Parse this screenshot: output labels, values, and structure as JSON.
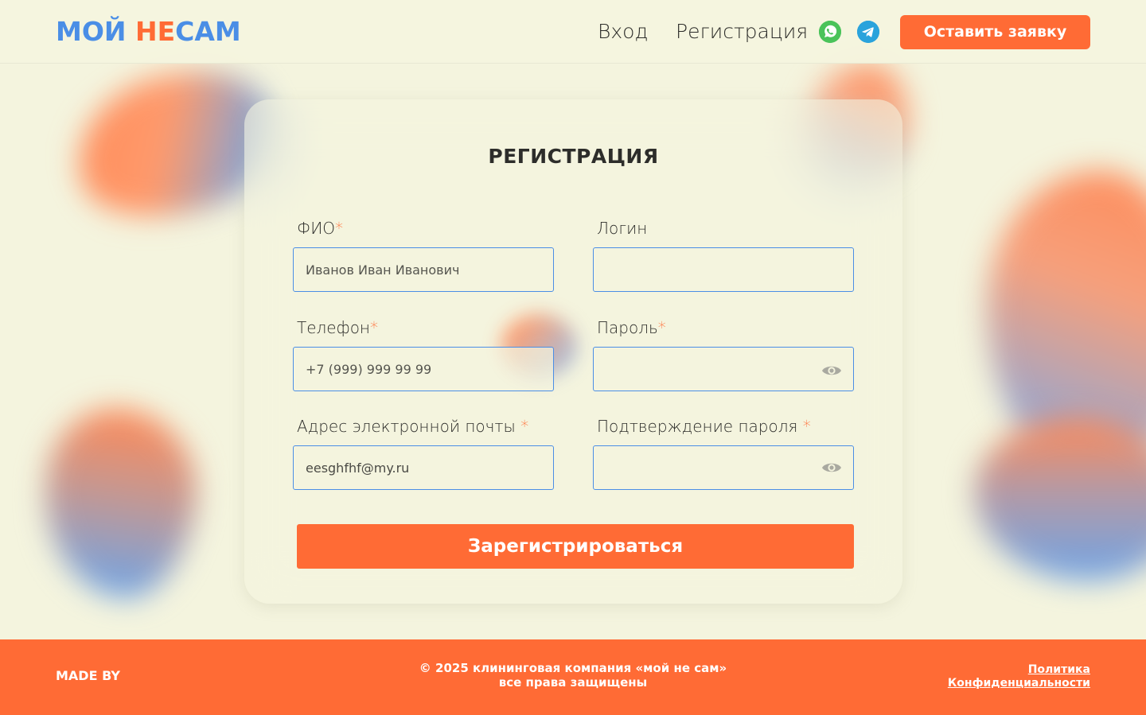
{
  "header": {
    "logo": {
      "part1": "МОЙ ",
      "part2": "НЕ",
      "part3": "САМ"
    },
    "nav": {
      "login": "Вход",
      "register": "Регистрация"
    },
    "social": [
      "whatsapp-icon",
      "telegram-icon"
    ],
    "cta_label": "Оставить заявку"
  },
  "form": {
    "title": "РЕГИСТРАЦИЯ",
    "fields": {
      "fio": {
        "label": "ФИО",
        "required": "*",
        "value": "",
        "placeholder": "Иванов Иван Иванович"
      },
      "login": {
        "label": "Логин",
        "required": "",
        "value": "",
        "placeholder": ""
      },
      "phone": {
        "label": "Телефон",
        "required": "*",
        "value": "",
        "placeholder": "+7 (999) 999 99 99"
      },
      "password": {
        "label": "Пароль",
        "required": "*",
        "value": "",
        "placeholder": ""
      },
      "email": {
        "label": "Адрес электронной почты ",
        "required": "*",
        "value": "eesghfhf@my.ru",
        "placeholder": ""
      },
      "password_confirm": {
        "label": "Подтверждение пароля ",
        "required": "*",
        "value": "",
        "placeholder": ""
      }
    },
    "submit_label": "Зарегистрироваться"
  },
  "footer": {
    "made_by": "MADE BY",
    "copyright_line1": "© 2025 клининговая компания «мой не сам»",
    "copyright_line2": "все права защищены",
    "policy_line1": "Политика",
    "policy_line2": "Конфиденциальности"
  },
  "colors": {
    "background": "#f4f4de",
    "accent": "#ff6b35",
    "blue": "#4a8ee6",
    "text": "#2d2d2a"
  }
}
